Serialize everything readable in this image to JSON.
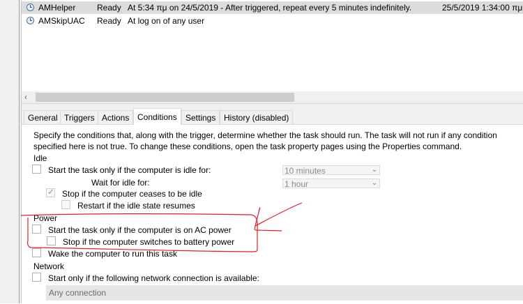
{
  "tasks": [
    {
      "name": "AMHelper",
      "status": "Ready",
      "trigger": "At 5:34 πμ on 24/5/2019 - After triggered, repeat every 5 minutes indefinitely.",
      "next_run": "25/5/2019 1:34:00 πμ"
    },
    {
      "name": "AMSkipUAC",
      "status": "Ready",
      "trigger": "At log on of any user",
      "next_run": ""
    }
  ],
  "scrollbar": {
    "left_arrow": "‹"
  },
  "tabs": [
    "General",
    "Triggers",
    "Actions",
    "Conditions",
    "Settings",
    "History (disabled)"
  ],
  "active_tab": "Conditions",
  "conditions": {
    "description": "Specify the conditions that, along with the trigger, determine whether the task should run.  The task will not run  if any condition specified here is not true.  To change these conditions, open the task property pages using the Properties command.",
    "idle": {
      "heading": "Idle",
      "start_if_idle": "Start the task only if the computer is idle for:",
      "idle_for_value": "10 minutes",
      "wait_label": "Wait for idle for:",
      "wait_value": "1 hour",
      "stop_if_not_idle": "Stop if the computer ceases to be idle",
      "restart_if_idle": "Restart if the idle state resumes"
    },
    "power": {
      "heading": "Power",
      "ac_power": "Start the task only if the computer is on AC power",
      "stop_on_battery": "Stop if the computer switches to battery power",
      "wake": "Wake the computer to run this task"
    },
    "network": {
      "heading": "Network",
      "start_if_network": "Start only if the following network connection is available:",
      "connection": "Any connection"
    }
  },
  "colors": {
    "annotation": "#e0202a",
    "selection": "#dcdcdc",
    "panel_bg": "#ffffff",
    "chrome_bg": "#f0f0f0"
  }
}
